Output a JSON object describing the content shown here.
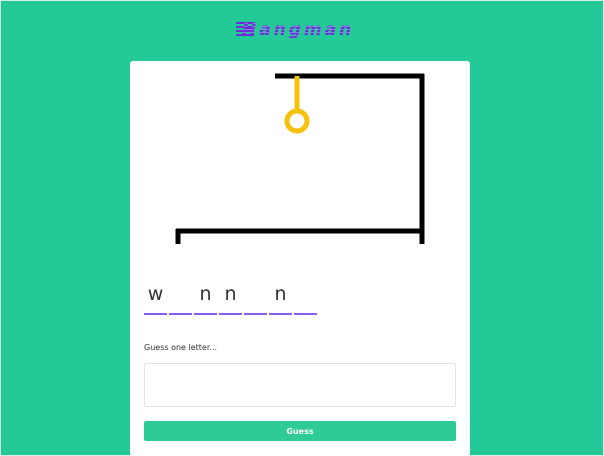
{
  "app": {
    "title": "Hangman"
  },
  "colors": {
    "background": "#23c997",
    "accent": "#6a2fd6",
    "underline": "#8b5cf0",
    "rope": "#f4c20d",
    "button": "#2ecb96"
  },
  "word_slots": [
    {
      "letter": "w"
    },
    {
      "letter": ""
    },
    {
      "letter": "n"
    },
    {
      "letter": "n"
    },
    {
      "letter": ""
    },
    {
      "letter": "n"
    },
    {
      "letter": ""
    }
  ],
  "guess": {
    "prompt": "Guess one letter...",
    "input_value": "",
    "input_placeholder": "",
    "button_label": "Guess"
  }
}
